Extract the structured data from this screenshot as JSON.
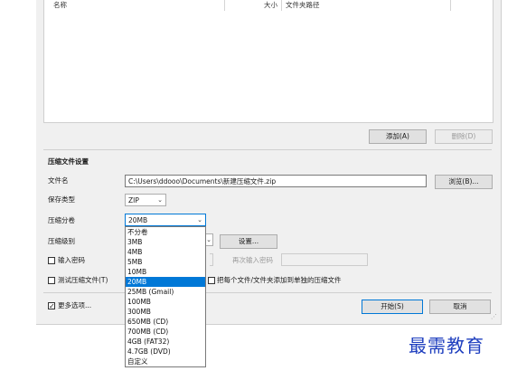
{
  "file_list": {
    "col_name": "名称",
    "col_size": "大小",
    "col_path": "文件夹路径"
  },
  "buttons": {
    "add": "添加(A)",
    "delete": "删除(D)",
    "browse": "浏览(B)...",
    "settings": "设置...",
    "start": "开始(S)",
    "cancel": "取消"
  },
  "settings": {
    "section_title": "压缩文件设置",
    "file_name_label": "文件名",
    "file_name_value": "C:\\Users\\ddooo\\Documents\\新建压缩文件.zip",
    "save_type_label": "保存类型",
    "save_type_value": "ZIP",
    "split_label": "压缩分卷",
    "split_value": "20MB",
    "level_label": "压缩级别",
    "password_label": "输入密码",
    "reenter_password_label": "再次输入密码",
    "test_label": "测试压缩文件(T)",
    "separate_label": "把每个文件/文件夹添加到单独的压缩文件",
    "more_options_label": "更多选项..."
  },
  "split_options": [
    "不分卷",
    "3MB",
    "4MB",
    "5MB",
    "10MB",
    "20MB",
    "25MB (Gmail)",
    "100MB",
    "300MB",
    "650MB (CD)",
    "700MB (CD)",
    "4GB (FAT32)",
    "4.7GB (DVD)",
    "自定义"
  ],
  "selected_split_index": 5,
  "checks": {
    "password": false,
    "test": false,
    "separate": false,
    "more_options": true
  },
  "icons": {
    "dropdown_arrow": "chevron-down-icon",
    "check": "checkmark-icon",
    "grip": "resize-grip-icon"
  },
  "colors": {
    "accent": "#0078d7",
    "watermark": "#1f3fbf"
  },
  "watermark": "最需教育"
}
